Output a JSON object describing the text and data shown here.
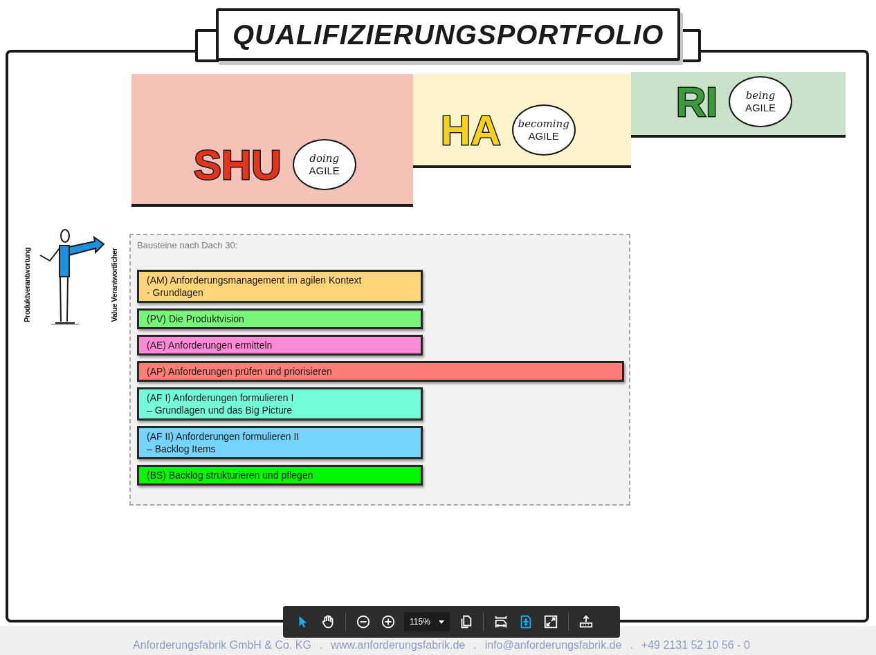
{
  "banner": {
    "title": "QUALIFIZIERUNGSPORTFOLIO"
  },
  "levels": [
    {
      "label": {
        "text": "SHU",
        "color": "#e0351f"
      },
      "color": "#f5c2b8",
      "bubble_top": "doing",
      "bubble_bottom": "AGILE"
    },
    {
      "label": {
        "text": "HA",
        "color": "#f5d21c"
      },
      "color": "#fdf3cc",
      "bubble_top": "becoming",
      "bubble_bottom": "AGILE"
    },
    {
      "label": {
        "text": "RI",
        "color": "#3c9a3c"
      },
      "color": "#c9e3c9",
      "bubble_top": "being",
      "bubble_bottom": "AGILE"
    }
  ],
  "figure": {
    "left_caption": "Produktverantwortung",
    "right_caption": "Value Verantwortlicher"
  },
  "modules": {
    "heading": "Bausteine nach Dach 30:",
    "items": [
      {
        "kind": "standard",
        "color": "#ffd57a",
        "text": "(AM) Anforderungsmanagement im agilen Kontext\n- Grundlagen"
      },
      {
        "kind": "standard",
        "color": "#77f777",
        "text": "(PV) Die Produktvision"
      },
      {
        "kind": "standard",
        "color": "#ff8ad8",
        "text": "(AE) Anforderungen ermitteln"
      },
      {
        "kind": "wide",
        "color": "#ff7f76",
        "text": "(AP) Anforderungen prüfen und priorisieren"
      },
      {
        "kind": "standard",
        "color": "#74fcd9",
        "text": "(AF I) Anforderungen formulieren I\n– Grundlagen und das Big Picture"
      },
      {
        "kind": "standard",
        "color": "#76d4fc",
        "text": "(AF II) Anforderungen formulieren II\n– Backlog Items"
      },
      {
        "kind": "standard",
        "color": "#00f900",
        "text": "(BS) Backlog strukturieren und pflegen"
      }
    ]
  },
  "toolbar": {
    "zoom": "115%",
    "tools": [
      {
        "kind": "pointer",
        "selected": true
      },
      {
        "kind": "hand",
        "selected": false
      },
      {
        "kind": "separator"
      },
      {
        "kind": "zoom-out",
        "selected": false
      },
      {
        "kind": "zoom-in",
        "selected": false
      },
      {
        "kind": "zoom-field"
      },
      {
        "kind": "pages",
        "selected": false
      },
      {
        "kind": "separator"
      },
      {
        "kind": "fit-width",
        "selected": false
      },
      {
        "kind": "fit-page",
        "selected": true
      },
      {
        "kind": "fullscreen",
        "selected": false
      },
      {
        "kind": "separator"
      },
      {
        "kind": "upload",
        "selected": false
      }
    ]
  },
  "footer": [
    {
      "kind": "text",
      "text": "Anforderungsfabrik GmbH & Co. KG"
    },
    {
      "kind": "separator",
      "text": "."
    },
    {
      "kind": "link",
      "text": "www.anforderungsfabrik.de"
    },
    {
      "kind": "separator",
      "text": "."
    },
    {
      "kind": "link",
      "text": "info@anforderungsfabrik.de"
    },
    {
      "kind": "separator",
      "text": "."
    },
    {
      "kind": "text",
      "text": "+49 2131 52 10 56 - 0"
    }
  ]
}
